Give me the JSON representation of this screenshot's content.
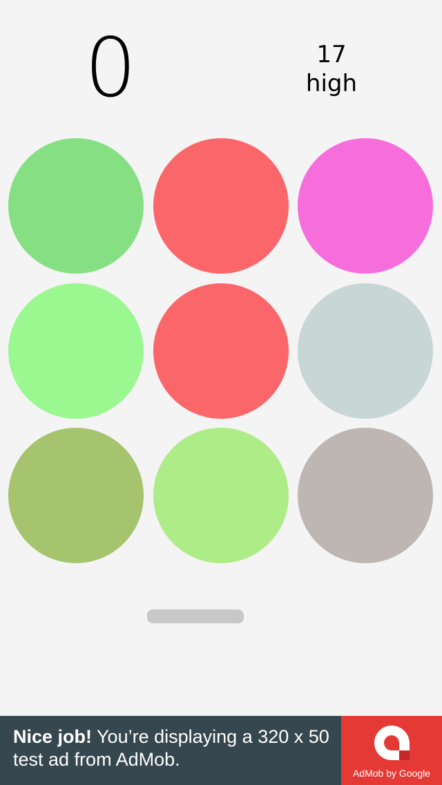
{
  "score": {
    "current": "0",
    "high_value": "17",
    "high_label": "high"
  },
  "board": {
    "circles": [
      {
        "color": "#86df82"
      },
      {
        "color": "#fb666a"
      },
      {
        "color": "#f66edc"
      },
      {
        "color": "#9bf790"
      },
      {
        "color": "#fb666a"
      },
      {
        "color": "#c8d6d6"
      },
      {
        "color": "#a6c46e"
      },
      {
        "color": "#aeec88"
      },
      {
        "color": "#bdb6b2"
      }
    ]
  },
  "timer": {
    "color": "#c8c8c8"
  },
  "ad": {
    "headline": "Nice job!",
    "body": " You’re displaying a 320 x 50 test ad from AdMob.",
    "brand": "AdMob by Google",
    "background": "#37474f",
    "logo_background": "#e53935"
  }
}
